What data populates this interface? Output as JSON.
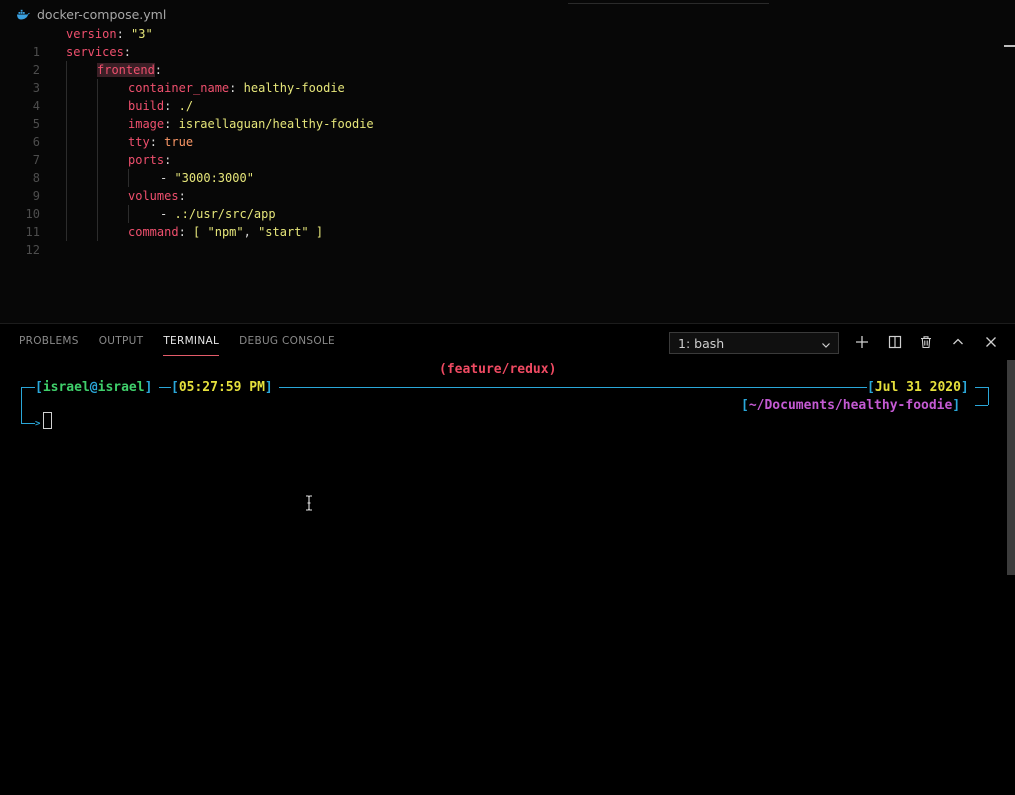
{
  "editor": {
    "filename": "docker-compose.yml",
    "icon": "docker-icon",
    "lines": [
      {
        "n": "1"
      },
      {
        "n": "2"
      },
      {
        "n": "3"
      },
      {
        "n": "4"
      },
      {
        "n": "5"
      },
      {
        "n": "6"
      },
      {
        "n": "7"
      },
      {
        "n": "8"
      },
      {
        "n": "9"
      },
      {
        "n": "10"
      },
      {
        "n": "11"
      },
      {
        "n": "12"
      }
    ],
    "code": {
      "l1_key": "version",
      "l1_val": "\"3\"",
      "l2_key": "services",
      "l3_key": "frontend",
      "l4_key": "container_name",
      "l4_val": "healthy-foodie",
      "l5_key": "build",
      "l5_val": "./",
      "l6_key": "image",
      "l6_val": "israellaguan/healthy-foodie",
      "l7_key": "tty",
      "l7_val": "true",
      "l8_key": "ports",
      "l9_dash": "- ",
      "l9_val": "\"3000:3000\"",
      "l10_key": "volumes",
      "l11_dash": "- ",
      "l11_val": ".:/usr/src/app",
      "l12_key": "command",
      "l12_open": "[ ",
      "l12_a": "\"npm\"",
      "l12_comma": ", ",
      "l12_b": "\"start\"",
      "l12_close": " ]",
      "colon": ":"
    }
  },
  "panel": {
    "tabs": [
      {
        "label": "PROBLEMS",
        "active": false
      },
      {
        "label": "OUTPUT",
        "active": false
      },
      {
        "label": "TERMINAL",
        "active": true
      },
      {
        "label": "DEBUG CONSOLE",
        "active": false
      }
    ],
    "terminal_select": "1: bash",
    "actions": [
      "plus-icon",
      "split-icon",
      "trash-icon",
      "chevron-up-icon",
      "close-icon"
    ]
  },
  "terminal": {
    "branch": "(feature/redux)",
    "user": "israel",
    "at": "@",
    "host": "israel",
    "time": "05:27:59 PM",
    "date": "Jul 31 2020",
    "path": "~/Documents/healthy-foodie",
    "bracket_open": "[",
    "bracket_close": "]"
  },
  "colors": {
    "keyword": "#f0506e",
    "string": "#e6e67a",
    "boolean": "#fc9867",
    "terminal_frame": "#2aa7d9",
    "terminal_user": "#3fcf6b",
    "terminal_time": "#e5e03c",
    "terminal_path": "#c45ad3",
    "terminal_branch": "#ef4a62"
  }
}
